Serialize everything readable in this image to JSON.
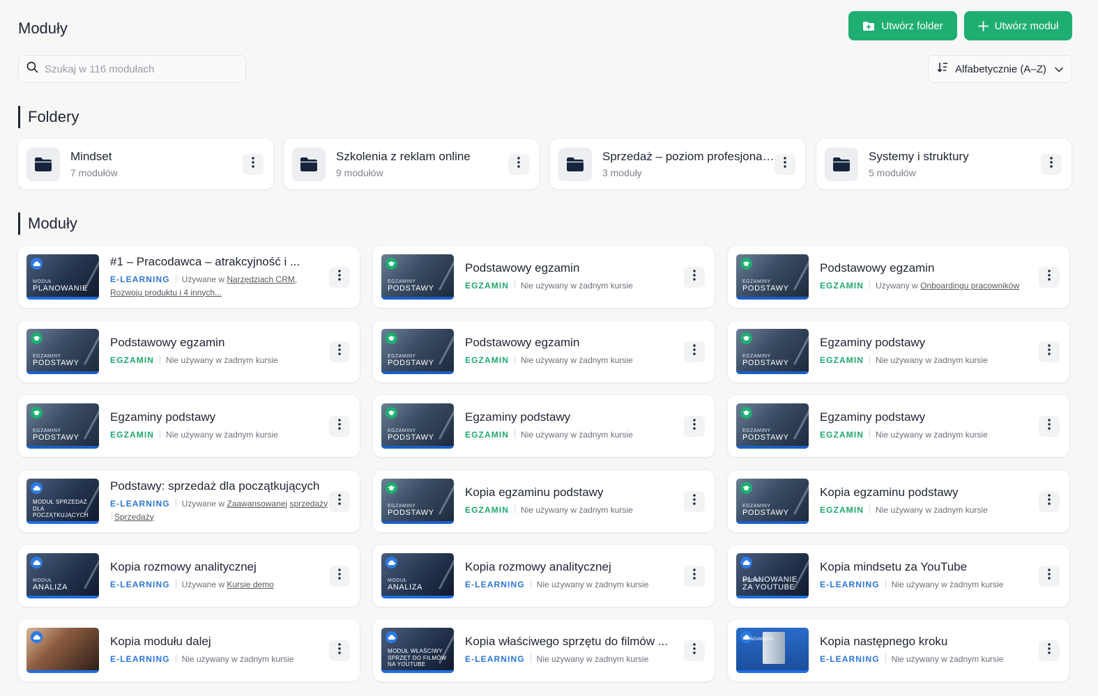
{
  "header": {
    "title": "Moduły",
    "create_folder_label": "Utwórz folder",
    "create_module_label": "Utwórz moduł",
    "accent_color": "#1eae72"
  },
  "search": {
    "placeholder": "Szukaj w 116 modułach",
    "value": ""
  },
  "sort": {
    "label": "Alfabetycznie (A–Z)"
  },
  "folders_section": {
    "title": "Foldery"
  },
  "folders": [
    {
      "name": "Mindset",
      "count": "7 modułów"
    },
    {
      "name": "Szkolenia z reklam online",
      "count": "9 modułów"
    },
    {
      "name": "Sprzedaż – poziom profesjonalny",
      "count": "3 moduły"
    },
    {
      "name": "Systemy i struktury",
      "count": "5 modułów"
    }
  ],
  "modules_section": {
    "title": "Moduły"
  },
  "type_colors": {
    "EGZAMIN": "#1fa86d",
    "E-LEARNING": "#2b76d9"
  },
  "modules": [
    {
      "title": "#1 – Pracodawca – atrakcyjność i ...",
      "type": "E-LEARNING",
      "used_prefix": "Używane w",
      "link1": "Narzędziach CRM,",
      "link2": "Rozwoju produktu i 4 innych...",
      "thumb_small": "Moduł",
      "thumb_big": "PLANOWANIE"
    },
    {
      "title": "Podstawowy egzamin",
      "type": "EGZAMIN",
      "status": "Nie używany w żadnym kursie",
      "thumb_small": "Egzaminy",
      "thumb_big": "PODSTAWY"
    },
    {
      "title": "Podstawowy egzamin",
      "type": "EGZAMIN",
      "used_prefix": "Używany w",
      "link1": "Onboardingu pracowników",
      "thumb_small": "Egzaminy",
      "thumb_big": "PODSTAWY"
    },
    {
      "title": "Podstawowy egzamin",
      "type": "EGZAMIN",
      "status": "Nie używany w żadnym kursie",
      "thumb_small": "Egzaminy",
      "thumb_big": "PODSTAWY"
    },
    {
      "title": "Podstawowy egzamin",
      "type": "EGZAMIN",
      "status": "Nie używany w żadnym kursie",
      "thumb_small": "Egzaminy",
      "thumb_big": "PODSTAWY"
    },
    {
      "title": "Egzaminy podstawy",
      "type": "EGZAMIN",
      "status": "Nie używany w żadnym kursie",
      "thumb_small": "Egzaminy",
      "thumb_big": "PODSTAWY"
    },
    {
      "title": "Egzaminy podstawy",
      "type": "EGZAMIN",
      "status": "Nie używany w żadnym kursie",
      "thumb_small": "Egzaminy",
      "thumb_big": "PODSTAWY"
    },
    {
      "title": "Egzaminy podstawy",
      "type": "EGZAMIN",
      "status": "Nie używany w żadnym kursie",
      "thumb_small": "Egzaminy",
      "thumb_big": "PODSTAWY"
    },
    {
      "title": "Egzaminy podstawy",
      "type": "EGZAMIN",
      "status": "Nie używany w żadnym kursie",
      "thumb_small": "Egzaminy",
      "thumb_big": "PODSTAWY"
    },
    {
      "title": "Podstawy: sprzedaż dla początkujących",
      "type": "E-LEARNING",
      "used_prefix": "Używane w",
      "link1": "Zaawansowanej",
      "link2": "sprzedaży",
      "link3": "Sprzedaży",
      "thumb_multi": "Moduł Sprzedaż dla początkujących"
    },
    {
      "title": "Kopia egzaminu podstawy",
      "type": "EGZAMIN",
      "status": "Nie używany w żadnym kursie",
      "thumb_small": "Egzaminy",
      "thumb_big": "PODSTAWY"
    },
    {
      "title": "Kopia egzaminu podstawy",
      "type": "EGZAMIN",
      "status": "Nie używany w żadnym kursie",
      "thumb_small": "Egzaminy",
      "thumb_big": "PODSTAWY"
    },
    {
      "title": "Kopia rozmowy analitycznej",
      "type": "E-LEARNING",
      "used_prefix": "Używane w",
      "link1": "Kursie demo",
      "thumb_small": "Moduł",
      "thumb_big": "ANALIZA"
    },
    {
      "title": "Kopia rozmowy analitycznej",
      "type": "E-LEARNING",
      "status": "Nie używany w żadnym kursie",
      "thumb_small": "Moduł",
      "thumb_big": "ANALIZA"
    },
    {
      "title": "Kopia mindsetu za YouTube",
      "type": "E-LEARNING",
      "status": "Nie używany w żadnym kursie",
      "thumb_small": "Moduł",
      "thumb_big": "PLANOWANIE ZA YOUTUBE"
    },
    {
      "title": "Kopia modułu dalej",
      "type": "E-LEARNING",
      "status": "Nie używany w żadnym kursie"
    },
    {
      "title": "Kopia właściwego sprzętu do filmów ...",
      "type": "E-LEARNING",
      "status": "Nie używany w żadnym kursie",
      "thumb_multi": "Moduł Właściwy sprzęt do filmów na YouTube"
    },
    {
      "title": "Kopia następnego kroku",
      "type": "E-LEARNING",
      "status": "Nie używany w żadnym kursie",
      "thumb_box": "ADVANCED"
    }
  ]
}
